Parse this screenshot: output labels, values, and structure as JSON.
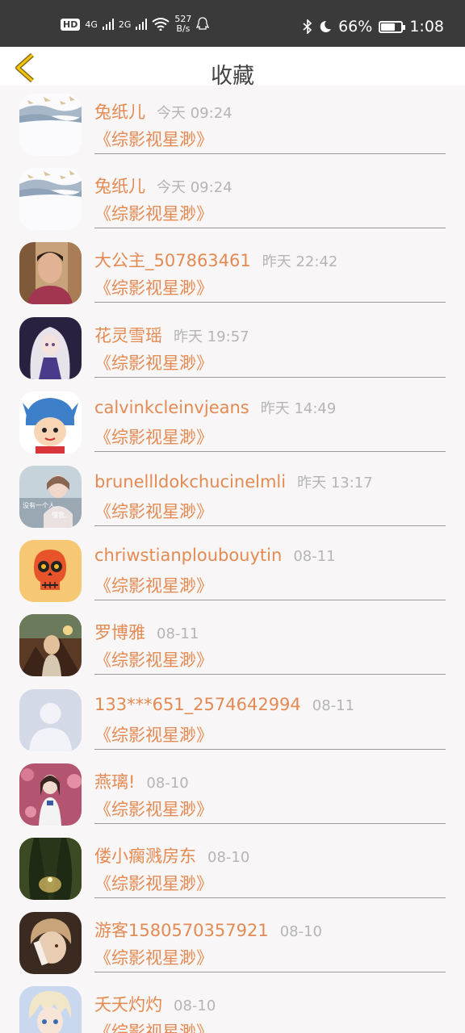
{
  "status_bar": {
    "hd": "HD",
    "sim1": "4G",
    "sim2": "2G",
    "speed_value": "527",
    "speed_unit": "B/s",
    "battery": "66%",
    "battery_level": 0.66,
    "time": "1:08"
  },
  "header": {
    "title": "收藏"
  },
  "items": [
    {
      "name": "兔纸儿",
      "time": "今天 09:24",
      "book": "《综影视星渺》",
      "avatar": "crane-painting"
    },
    {
      "name": "兔纸儿",
      "time": "今天 09:24",
      "book": "《综影视星渺》",
      "avatar": "crane-painting"
    },
    {
      "name": "大公主_507863461",
      "time": "昨天 22:42",
      "book": "《综影视星渺》",
      "avatar": "woman-portrait"
    },
    {
      "name": "花灵雪瑶",
      "time": "昨天 19:57",
      "book": "《综影视星渺》",
      "avatar": "anime-girl"
    },
    {
      "name": "calvinkcleinvjeans",
      "time": "昨天 14:49",
      "book": "《综影视星渺》",
      "avatar": "stitch-costume"
    },
    {
      "name": "brunellldokchucinelmli",
      "time": "昨天 13:17",
      "book": "《综影视星渺》",
      "avatar": "girl-photo"
    },
    {
      "name": "chriwstianploubouytin",
      "time": "08-11",
      "book": "《综影视星渺》",
      "avatar": "sugar-skull"
    },
    {
      "name": "罗博雅",
      "time": "08-11",
      "book": "《综影视星渺》",
      "avatar": "fantasy-art"
    },
    {
      "name": "133***651_2574642994",
      "time": "08-11",
      "book": "《综影视星渺》",
      "avatar": "default-person"
    },
    {
      "name": "燕璃!",
      "time": "08-10",
      "book": "《综影视星渺》",
      "avatar": "girl-flowers"
    },
    {
      "name": "偻小瘸溅房东",
      "time": "08-10",
      "book": "《综影视星渺》",
      "avatar": "forest"
    },
    {
      "name": "游客1580570357921",
      "time": "08-10",
      "book": "《综影视星渺》",
      "avatar": "anime-boy"
    },
    {
      "name": "夭夭灼灼",
      "time": "08-10",
      "book": "《综影视星渺》",
      "avatar": "anime-blue"
    }
  ]
}
